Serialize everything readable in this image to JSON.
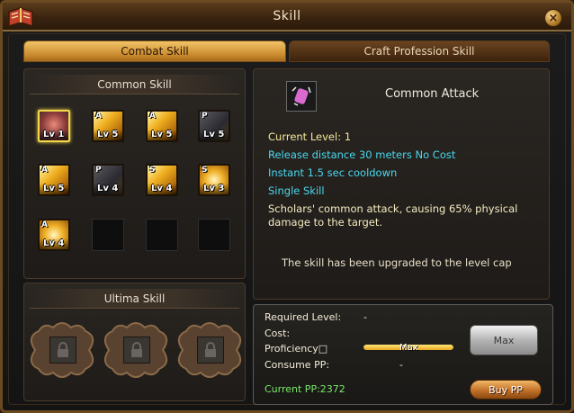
{
  "window": {
    "title": "Skill",
    "close_label": "×"
  },
  "tabs": [
    {
      "label": "Combat Skill",
      "active": true
    },
    {
      "label": "Craft Profession Skill",
      "active": false
    }
  ],
  "common": {
    "header": "Common Skill",
    "slots": [
      {
        "letter": "",
        "level": "Lv 1",
        "icon": "fist-attack-icon",
        "selected": true
      },
      {
        "letter": "A",
        "level": "Lv 5",
        "icon": "gold-skill-icon",
        "selected": false
      },
      {
        "letter": "A",
        "level": "Lv 5",
        "icon": "gold-skill-icon",
        "selected": false
      },
      {
        "letter": "P",
        "level": "Lv 5",
        "icon": "quill-icon",
        "selected": false
      },
      {
        "letter": "A",
        "level": "Lv 5",
        "icon": "gold-skill-icon",
        "selected": false
      },
      {
        "letter": "P",
        "level": "Lv 4",
        "icon": "gear-icon",
        "selected": false
      },
      {
        "letter": "S",
        "level": "Lv 4",
        "icon": "gold-skill-icon",
        "selected": false
      },
      {
        "letter": "S",
        "level": "Lv 3",
        "icon": "eye-skill-icon",
        "selected": false
      },
      {
        "letter": "A",
        "level": "Lv 4",
        "icon": "wave-skill-icon",
        "selected": false
      }
    ]
  },
  "ultima": {
    "header": "Ultima Skill",
    "slots": [
      "lock-icon",
      "lock-icon",
      "lock-icon"
    ]
  },
  "info": {
    "skill_name": "Common Attack",
    "current_level": "Current Level: 1",
    "release": "Release distance 30 meters No Cost",
    "instant": "Instant 1.5 sec cooldown",
    "single": "Single Skill",
    "desc_1": "Scholars' common attack, causing 65% physical",
    "desc_2": "damage to the target.",
    "cap": "The skill has been upgraded to the level cap"
  },
  "upgrade": {
    "required_level_label": "Required Level:",
    "required_level_value": "-",
    "cost_label": "Cost:",
    "proficiency_label": "Proficiency□",
    "proficiency_text": "Max",
    "proficiency_fraction": 1.0,
    "consume_label": "Consume PP:",
    "consume_value": "-",
    "max_button": "Max",
    "current_pp": "Current PP:2372",
    "buy_button": "Buy PP"
  },
  "colors": {
    "accent_gold": "#f2c469",
    "cyan_text": "#48d8ee",
    "pp_green": "#7ae86a"
  }
}
